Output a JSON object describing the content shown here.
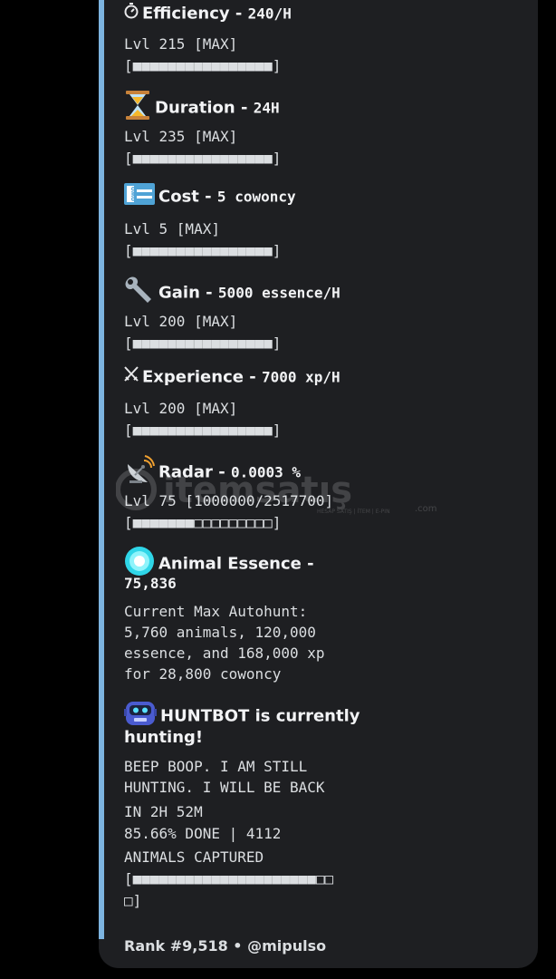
{
  "colors": {
    "accent": "#7db4e0",
    "background": "#000000",
    "embed_bg": "#1e1f22"
  },
  "stats": [
    {
      "icon": "stopwatch-icon",
      "label": "Efficiency",
      "sep": " - ",
      "value": "240/H",
      "level": "Lvl 215 [MAX]",
      "bar": "[■■■■■■■■■■■■■■■■]"
    },
    {
      "icon": "hourglass-icon",
      "label": "Duration",
      "sep": " - ",
      "value": "24H",
      "level": "Lvl 235 [MAX]",
      "bar": "[■■■■■■■■■■■■■■■■]"
    },
    {
      "icon": "owo-ticket-icon",
      "label": "Cost",
      "sep": " - ",
      "value": "5 cowoncy",
      "level": "Lvl 5 [MAX]",
      "bar": "[■■■■■■■■■■■■■■■■]"
    },
    {
      "icon": "wrench-icon",
      "label": "Gain",
      "sep": " - ",
      "value": "5000 essence/H",
      "level": "Lvl 200 [MAX]",
      "bar": "[■■■■■■■■■■■■■■■■]"
    },
    {
      "icon": "crossed-swords-icon",
      "label": "Experience",
      "sep": " - ",
      "value": "7000 xp/H",
      "level": "Lvl 200 [MAX]",
      "bar": "[■■■■■■■■■■■■■■■■]"
    },
    {
      "icon": "satellite-dish-icon",
      "label": "Radar",
      "sep": " - ",
      "value": "0.0003 %",
      "level": "Lvl 75 [1000000/2517700]",
      "bar": "[■■■■■■■□□□□□□□□□]",
      "progress": 0.397
    }
  ],
  "essence": {
    "icon": "essence-orb-icon",
    "label": "Animal Essence -",
    "value": "75,836",
    "lines": [
      "Current Max Autohunt:",
      "5,760 animals, 120,000",
      "essence, and 168,000 xp",
      "for 28,800 cowoncy"
    ]
  },
  "huntbot": {
    "icon": "robot-icon",
    "title_line1": "HUNTBOT is currently",
    "title_line2": "hunting!",
    "lines": [
      "BEEP BOOP. I AM STILL",
      "HUNTING. I WILL BE BACK",
      "IN 2H 52M",
      "85.66% DONE | 4112",
      "ANIMALS CAPTURED",
      "[■■■■■■■■■■■■■■■■■■■■■□□",
      "□]"
    ],
    "progress": 0.8566
  },
  "footer": {
    "text": "Rank #9,518 • @mipulso"
  },
  "watermark": {
    "brand": "itemsatış",
    "tagline": "HESAP SATIŞ | İTEM | E-PIN",
    "domain": ".com"
  }
}
